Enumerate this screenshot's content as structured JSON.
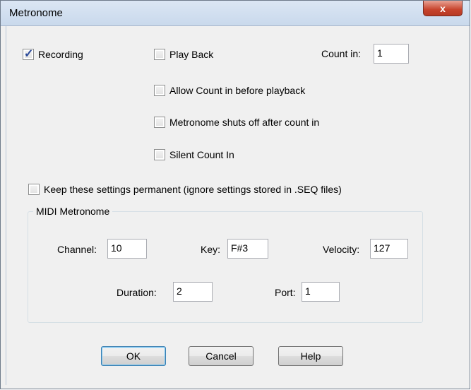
{
  "window": {
    "title": "Metronome",
    "close_label": "x"
  },
  "options": {
    "recording": {
      "label": "Recording",
      "checked": true
    },
    "play_back": {
      "label": "Play Back",
      "checked": false
    },
    "count_in": {
      "label": "Count in:",
      "value": "1"
    },
    "allow_count_in": {
      "label": "Allow Count in before playback",
      "checked": false
    },
    "shuts_off": {
      "label": "Metronome shuts off after count in",
      "checked": false
    },
    "silent_count_in": {
      "label": "Silent Count In",
      "checked": false
    },
    "keep_settings": {
      "label": "Keep these settings permanent (ignore settings stored in .SEQ files)",
      "checked": false
    }
  },
  "midi": {
    "group_label": "MIDI Metronome",
    "channel": {
      "label": "Channel:",
      "value": "10"
    },
    "key": {
      "label": "Key:",
      "value": "F#3"
    },
    "velocity": {
      "label": "Velocity:",
      "value": "127"
    },
    "duration": {
      "label": "Duration:",
      "value": "2"
    },
    "port": {
      "label": "Port:",
      "value": "1"
    }
  },
  "buttons": {
    "ok": "OK",
    "cancel": "Cancel",
    "help": "Help"
  }
}
